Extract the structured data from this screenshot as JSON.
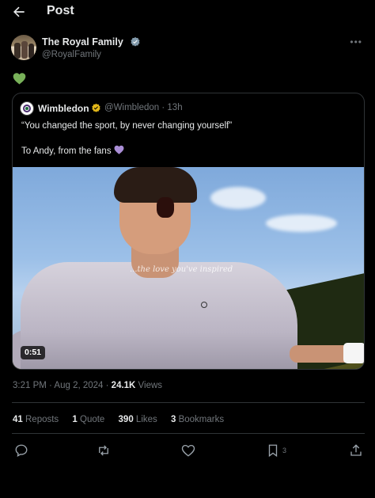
{
  "header": {
    "title": "Post"
  },
  "post": {
    "author_name": "The Royal Family",
    "author_handle": "@RoyalFamily",
    "text_emoji": "green-heart"
  },
  "quote": {
    "author_name": "Wimbledon",
    "meta": "@Wimbledon · 13h",
    "line1": "“You changed the sport, by never changing yourself”",
    "line2": "To Andy, from the fans",
    "video": {
      "duration": "0:51",
      "overlay_caption": "...the love you've inspired"
    }
  },
  "meta": {
    "time": "3:21 PM · Aug 2, 2024 · ",
    "views_count": "24.1K",
    "views_label": " Views"
  },
  "stats": {
    "reposts_count": "41",
    "reposts_label": "Reposts",
    "quotes_count": "1",
    "quotes_label": "Quote",
    "likes_count": "390",
    "likes_label": "Likes",
    "bookmarks_count": "3",
    "bookmarks_label": "Bookmarks"
  },
  "actions": {
    "bookmark_count": "3"
  },
  "colors": {
    "background": "#000000",
    "text": "#e7e9ea",
    "muted": "#71767b",
    "border": "#2f3336",
    "gold_badge": "#e2b719",
    "heart_green": "#78b159",
    "heart_purple": "#aa8ed6"
  }
}
